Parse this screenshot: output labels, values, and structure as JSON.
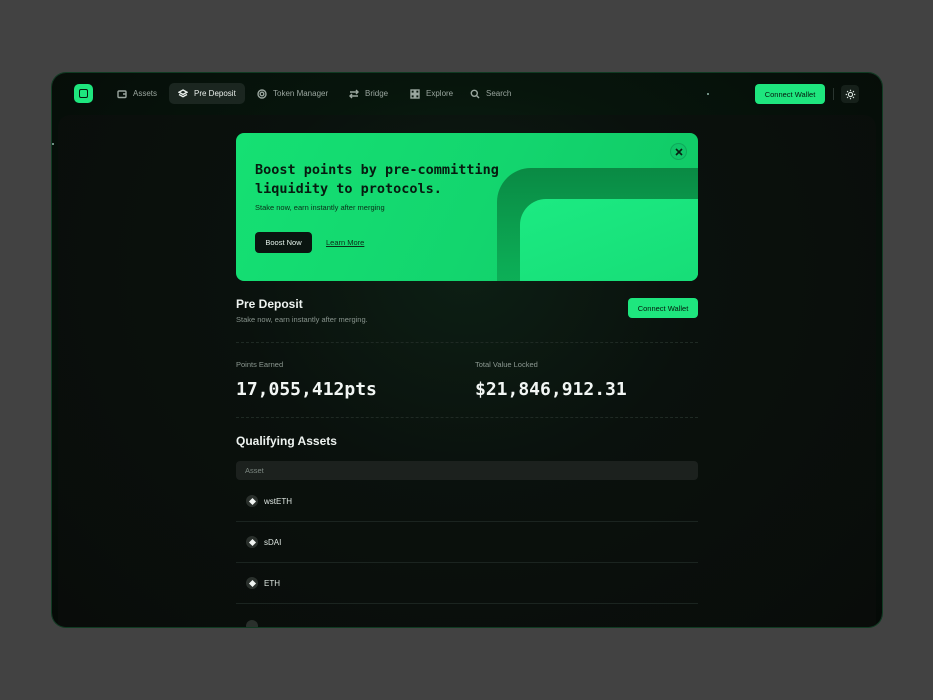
{
  "nav": {
    "items": [
      {
        "label": "Assets",
        "icon": "wallet-icon",
        "active": false
      },
      {
        "label": "Pre Deposit",
        "icon": "layers-icon",
        "active": true
      },
      {
        "label": "Token Manager",
        "icon": "token-icon",
        "active": false
      },
      {
        "label": "Bridge",
        "icon": "arrows-exchange-icon",
        "active": false
      },
      {
        "label": "Explore",
        "icon": "grid-icon",
        "active": false
      },
      {
        "label": "Search",
        "icon": "search-icon",
        "active": false
      }
    ],
    "connect_label": "Connect Wallet",
    "theme_icon": "sun-icon"
  },
  "banner": {
    "title": "Boost points by pre-committing liquidity to protocols.",
    "subtitle": "Stake now, earn instantly after merging",
    "boost_label": "Boost Now",
    "learn_label": "Learn More",
    "close_icon": "close-icon"
  },
  "pre_deposit": {
    "title": "Pre Deposit",
    "subtitle": "Stake now, earn instantly after merging.",
    "connect_label": "Connect Wallet"
  },
  "stats": {
    "points_label": "Points Earned",
    "points_value": "17,055,412pts",
    "tvl_label": "Total Value Locked",
    "tvl_value": "$21,846,912.31"
  },
  "qualifying": {
    "title": "Qualifying Assets",
    "column": "Asset",
    "assets": [
      "wstETH",
      "sDAI",
      "ETH"
    ]
  },
  "colors": {
    "accent": "#1ee67e",
    "background": "#424242",
    "panel": "#090c0a"
  }
}
